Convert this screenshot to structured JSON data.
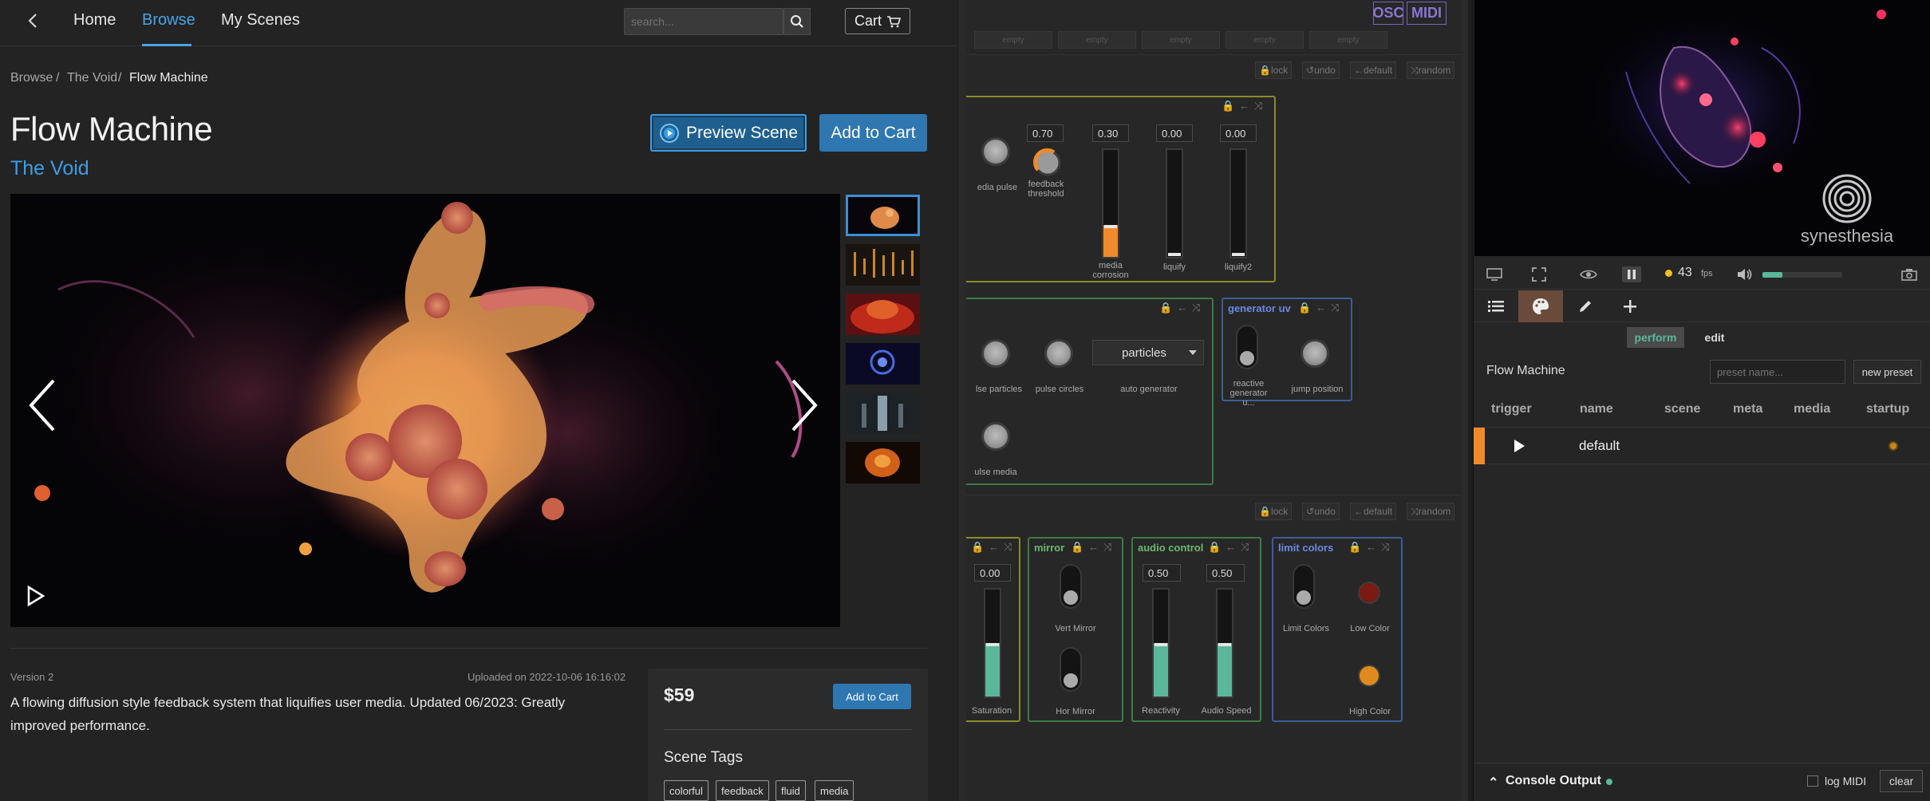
{
  "store": {
    "nav": {
      "back_icon": "chevron-left-icon",
      "home": "Home",
      "browse": "Browse",
      "my_scenes": "My Scenes"
    },
    "search": {
      "placeholder": "search..."
    },
    "cart_label": "Cart",
    "breadcrumb": [
      "Browse",
      "/",
      "The Void",
      "/",
      "Flow Machine"
    ],
    "title": "Flow Machine",
    "creator": "The Void",
    "preview_button": "Preview Scene",
    "add_to_cart": "Add to Cart",
    "version": "Version 2",
    "uploaded": "Uploaded on 2022-10-06 16:16:02",
    "description": "A flowing diffusion style feedback system that liquifies user media. Updated 06/2023: Greatly improved performance.",
    "price": "$59",
    "buy_add_to_cart": "Add to Cart",
    "tags_title": "Scene Tags",
    "tags": [
      "colorful",
      "feedback",
      "fluid",
      "media"
    ]
  },
  "controls": {
    "osc": "OSC",
    "midi": "MIDI",
    "empty_label": "empty",
    "section_buttons": {
      "lock": "lock",
      "undo": "undo",
      "default": "default",
      "random": "random"
    },
    "group1": {
      "labels": {
        "media_pulse": "edia pulse",
        "feedback_threshold": "feedback threshold",
        "media_corrosion": "media corrosion",
        "liquify": "liquify",
        "liquify2": "liquify2"
      },
      "values": {
        "feedback_threshold": "0.70",
        "media_corrosion": "0.30",
        "liquify": "0.00",
        "liquify2": "0.00"
      },
      "levels": {
        "media_corrosion": 0.3,
        "liquify": 0.0,
        "liquify2": 0.0
      }
    },
    "group2": {
      "labels": {
        "pulse_particles": "lse particles",
        "pulse_circles": "pulse circles",
        "auto_generator": "auto generator",
        "pulse_media": "ulse media"
      },
      "auto_generator_value": "particles"
    },
    "generator_uv": {
      "title": "generator uv",
      "reactive": "reactive generator u...",
      "jump_position": "jump position"
    },
    "color_group": {
      "value": "0.00",
      "label": "Saturation",
      "level": 0.5
    },
    "mirror": {
      "title": "mirror",
      "vert": "Vert Mirror",
      "hor": "Hor Mirror"
    },
    "audio_control": {
      "title": "audio control",
      "reactivity": "Reactivity",
      "audio_speed": "Audio Speed",
      "reactivity_value": "0.50",
      "audio_speed_value": "0.50",
      "reactivity_level": 0.5,
      "audio_speed_level": 0.5
    },
    "limit_colors": {
      "title": "limit colors",
      "limit": "Limit Colors",
      "low": "Low Color",
      "high": "High Color",
      "low_color": "#7a1a12",
      "high_color": "#e08a1e"
    }
  },
  "synesthesia": {
    "logo_text": "synesthesia",
    "fps_value": "43",
    "fps_unit": "fps",
    "volume_level": 0.25,
    "perform_tab": "perform",
    "edit_tab": "edit",
    "preset_title": "Flow Machine",
    "preset_placeholder": "preset name...",
    "new_preset": "new preset",
    "columns": [
      "trigger",
      "name",
      "scene",
      "meta",
      "media",
      "startup"
    ],
    "row_name": "default",
    "console_title": "Console Output",
    "log_midi": "log MIDI",
    "clear": "clear"
  },
  "colors": {
    "accent_blue": "#3b9fe8",
    "yellow_group": "#8a8c2a",
    "green_group": "#3e7a44",
    "blue_group": "#3c5e9a",
    "orange": "#f08a2a",
    "teal": "#5ab79a"
  }
}
